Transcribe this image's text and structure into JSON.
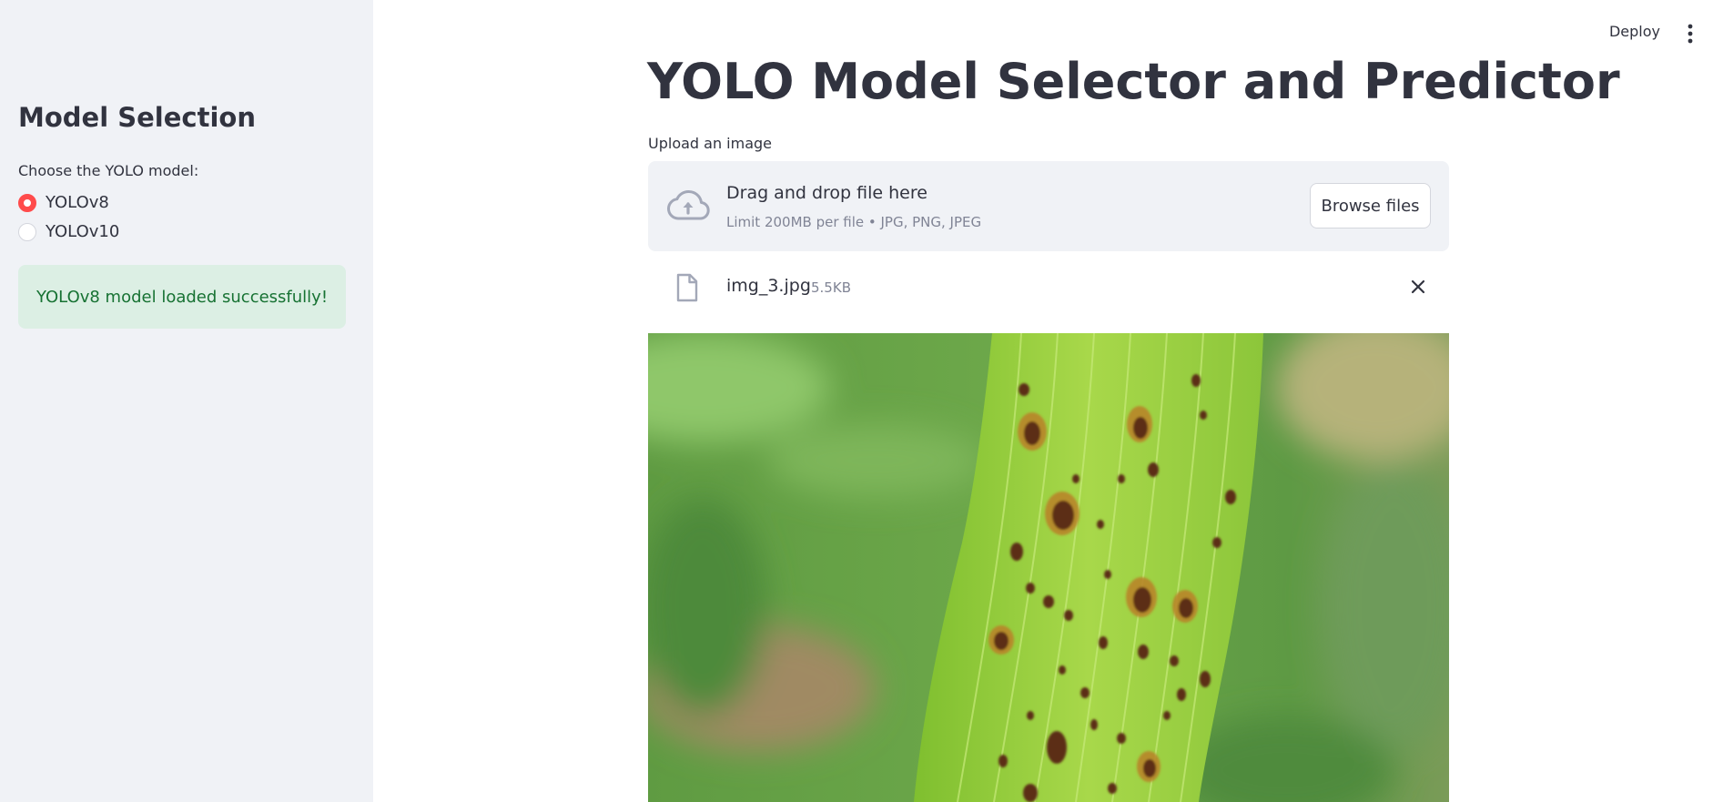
{
  "header": {
    "deploy_label": "Deploy",
    "menu_icon": "vertical-dots-icon"
  },
  "sidebar": {
    "heading": "Model Selection",
    "radio_label": "Choose the YOLO model:",
    "options": [
      {
        "label": "YOLOv8",
        "selected": true
      },
      {
        "label": "YOLOv10",
        "selected": false
      }
    ],
    "success_message": "YOLOv8 model loaded successfully!"
  },
  "main": {
    "title": "YOLO Model Selector and Predictor",
    "uploader": {
      "label": "Upload an image",
      "dropzone_title": "Drag and drop file here",
      "dropzone_limit": "Limit 200MB per file • JPG, PNG, JPEG",
      "browse_label": "Browse files",
      "upload_icon": "cloud-upload-icon"
    },
    "file": {
      "name": "img_3.jpg",
      "size": "5.5KB",
      "file_icon": "file-icon",
      "remove_icon": "close-icon"
    },
    "image": {
      "subject": "leaf-with-brown-spots"
    }
  },
  "colors": {
    "sidebar_bg": "#f0f2f6",
    "accent": "#ff4b4b",
    "success_bg": "#dcefe4",
    "success_text": "#177233",
    "text": "#31333f",
    "muted_text": "#808495"
  }
}
